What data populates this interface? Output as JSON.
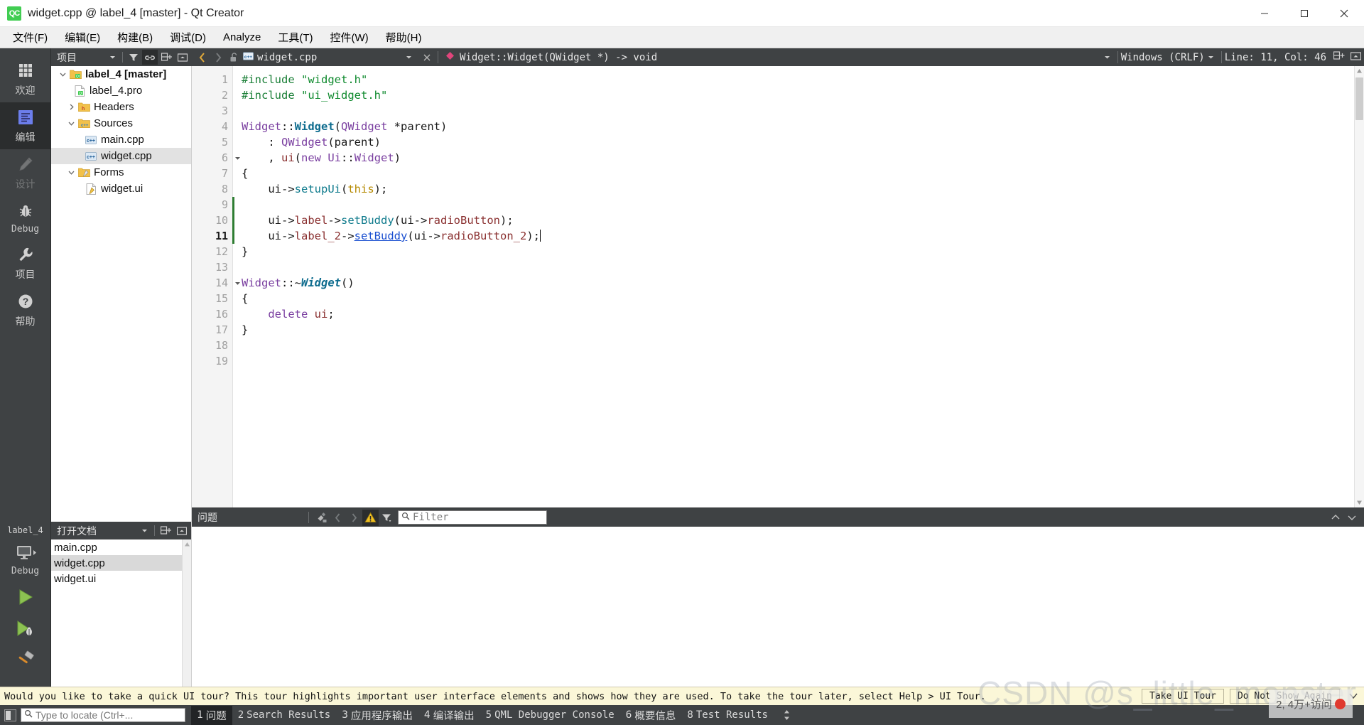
{
  "window": {
    "title": "widget.cpp @ label_4 [master] - Qt Creator",
    "app_icon_text": "QC",
    "controls": {
      "minimize": "minimize-icon",
      "maximize": "maximize-icon",
      "close": "close-icon"
    }
  },
  "menubar": {
    "items": [
      {
        "label": "文件(F)",
        "plain": "文件",
        "mnemonic": "F"
      },
      {
        "label": "编辑(E)",
        "plain": "编辑",
        "mnemonic": "E"
      },
      {
        "label": "构建(B)",
        "plain": "构建",
        "mnemonic": "B"
      },
      {
        "label": "调试(D)",
        "plain": "调试",
        "mnemonic": "D"
      },
      {
        "label": "Analyze",
        "plain": "Analyze",
        "mnemonic": "A"
      },
      {
        "label": "工具(T)",
        "plain": "工具",
        "mnemonic": "T"
      },
      {
        "label": "控件(W)",
        "plain": "控件",
        "mnemonic": "W"
      },
      {
        "label": "帮助(H)",
        "plain": "帮助",
        "mnemonic": "H"
      }
    ]
  },
  "modebar": {
    "items": [
      {
        "label": "欢迎",
        "icon": "grid-icon",
        "state": "normal"
      },
      {
        "label": "编辑",
        "icon": "editor-icon",
        "state": "active"
      },
      {
        "label": "设计",
        "icon": "pencil-icon",
        "state": "disabled"
      },
      {
        "label": "Debug",
        "icon": "bug-icon",
        "state": "normal"
      },
      {
        "label": "项目",
        "icon": "wrench-icon",
        "state": "normal"
      },
      {
        "label": "帮助",
        "icon": "question-circle-icon",
        "state": "normal"
      }
    ],
    "kit": {
      "project": "label_4",
      "icon": "monitor-icon",
      "build_config": "Debug"
    },
    "run_buttons": [
      {
        "name": "run-button",
        "icon": "play-triangle-icon"
      },
      {
        "name": "debug-button",
        "icon": "play-with-bug-icon"
      },
      {
        "name": "build-button",
        "icon": "hammer-icon"
      }
    ]
  },
  "project_dock": {
    "title": "项目",
    "tools": [
      "filter-icon",
      "link-icon",
      "split-icon",
      "close-dock-icon"
    ],
    "tree": [
      {
        "label": "label_4 [master]",
        "icon": "qt-project-folder-icon",
        "depth": 0,
        "expander": "down",
        "bold": true,
        "selected": false
      },
      {
        "label": "label_4.pro",
        "icon": "pro-file-icon",
        "depth": 1,
        "expander": "none",
        "bold": false,
        "selected": false
      },
      {
        "label": "Headers",
        "icon": "headers-folder-icon",
        "depth": 1,
        "expander": "right",
        "bold": false,
        "selected": false
      },
      {
        "label": "Sources",
        "icon": "sources-folder-icon",
        "depth": 1,
        "expander": "down",
        "bold": false,
        "selected": false
      },
      {
        "label": "main.cpp",
        "icon": "cpp-file-icon",
        "depth": 2,
        "expander": "none",
        "bold": false,
        "selected": false
      },
      {
        "label": "widget.cpp",
        "icon": "cpp-file-icon",
        "depth": 2,
        "expander": "none",
        "bold": false,
        "selected": true
      },
      {
        "label": "Forms",
        "icon": "forms-folder-icon",
        "depth": 1,
        "expander": "down",
        "bold": false,
        "selected": false
      },
      {
        "label": "widget.ui",
        "icon": "ui-file-icon",
        "depth": 2,
        "expander": "none",
        "bold": false,
        "selected": false
      }
    ]
  },
  "opendocs_dock": {
    "title": "打开文档",
    "tools": [
      "split-icon",
      "close-dock-icon"
    ],
    "items": [
      {
        "label": "main.cpp",
        "selected": false
      },
      {
        "label": "widget.cpp",
        "selected": true
      },
      {
        "label": "widget.ui",
        "selected": false
      }
    ]
  },
  "editor_toolbar": {
    "nav_back": "back-arrow-icon",
    "nav_forward": "forward-arrow-icon",
    "lock": "unlocked-icon",
    "file_icon": "cpp-file-icon",
    "file_name": "widget.cpp",
    "close_label": "×",
    "symbol_icon": "method-diamond-icon",
    "symbol": "Widget::Widget(QWidget *) -> void",
    "line_ending": "Windows (CRLF)",
    "cursor_position": "Line: 11, Col: 46",
    "split_icon": "split-editor-icon",
    "unsplit_icon": "close-split-icon"
  },
  "code": {
    "lines": [
      {
        "n": 1,
        "fold": "none",
        "changed": false,
        "current": false,
        "tokens": [
          {
            "t": "#include ",
            "c": "k-pre"
          },
          {
            "t": "\"widget.h\"",
            "c": "k-str"
          }
        ]
      },
      {
        "n": 2,
        "fold": "none",
        "changed": false,
        "current": false,
        "tokens": [
          {
            "t": "#include ",
            "c": "k-pre"
          },
          {
            "t": "\"ui_widget.h\"",
            "c": "k-str"
          }
        ]
      },
      {
        "n": 3,
        "fold": "none",
        "changed": false,
        "current": false,
        "tokens": []
      },
      {
        "n": 4,
        "fold": "none",
        "changed": false,
        "current": false,
        "tokens": [
          {
            "t": "Widget",
            "c": "k-type"
          },
          {
            "t": "::",
            "c": "k-op"
          },
          {
            "t": "Widget",
            "c": "k-typeb"
          },
          {
            "t": "(",
            "c": "k-op"
          },
          {
            "t": "QWidget",
            "c": "k-type"
          },
          {
            "t": " *parent",
            "c": "k-plain"
          },
          {
            "t": ")",
            "c": "k-op"
          }
        ]
      },
      {
        "n": 5,
        "fold": "none",
        "changed": false,
        "current": false,
        "tokens": [
          {
            "t": "    : ",
            "c": "k-op"
          },
          {
            "t": "QWidget",
            "c": "k-type"
          },
          {
            "t": "(parent)",
            "c": "k-op"
          }
        ]
      },
      {
        "n": 6,
        "fold": "down",
        "changed": false,
        "current": false,
        "tokens": [
          {
            "t": "    , ",
            "c": "k-op"
          },
          {
            "t": "ui",
            "c": "k-var"
          },
          {
            "t": "(",
            "c": "k-op"
          },
          {
            "t": "new",
            "c": "k-kw"
          },
          {
            "t": " ",
            "c": "k-plain"
          },
          {
            "t": "Ui",
            "c": "k-type"
          },
          {
            "t": "::",
            "c": "k-op"
          },
          {
            "t": "Widget",
            "c": "k-type"
          },
          {
            "t": ")",
            "c": "k-op"
          }
        ]
      },
      {
        "n": 7,
        "fold": "none",
        "changed": false,
        "current": false,
        "tokens": [
          {
            "t": "{",
            "c": "k-op"
          }
        ]
      },
      {
        "n": 8,
        "fold": "none",
        "changed": false,
        "current": false,
        "tokens": [
          {
            "t": "    ui",
            "c": "k-plain"
          },
          {
            "t": "->",
            "c": "k-op"
          },
          {
            "t": "setupUi",
            "c": "k-fn"
          },
          {
            "t": "(",
            "c": "k-op"
          },
          {
            "t": "this",
            "c": "k-this"
          },
          {
            "t": ");",
            "c": "k-op"
          }
        ]
      },
      {
        "n": 9,
        "fold": "none",
        "changed": true,
        "current": false,
        "tokens": []
      },
      {
        "n": 10,
        "fold": "none",
        "changed": true,
        "current": false,
        "tokens": [
          {
            "t": "    ui",
            "c": "k-plain"
          },
          {
            "t": "->",
            "c": "k-op"
          },
          {
            "t": "label",
            "c": "k-var"
          },
          {
            "t": "->",
            "c": "k-op"
          },
          {
            "t": "setBuddy",
            "c": "k-fn"
          },
          {
            "t": "(ui",
            "c": "k-op"
          },
          {
            "t": "->",
            "c": "k-op"
          },
          {
            "t": "radioButton",
            "c": "k-var"
          },
          {
            "t": ");",
            "c": "k-op"
          }
        ]
      },
      {
        "n": 11,
        "fold": "none",
        "changed": true,
        "current": true,
        "tokens": [
          {
            "t": "    ui",
            "c": "k-plain"
          },
          {
            "t": "->",
            "c": "k-op"
          },
          {
            "t": "label_2",
            "c": "k-var"
          },
          {
            "t": "->",
            "c": "k-op"
          },
          {
            "t": "setBuddy",
            "c": "k-fnu"
          },
          {
            "t": "(ui",
            "c": "k-op"
          },
          {
            "t": "->",
            "c": "k-op"
          },
          {
            "t": "radioButton_2",
            "c": "k-var"
          },
          {
            "t": ");",
            "c": "k-op"
          }
        ]
      },
      {
        "n": 12,
        "fold": "none",
        "changed": false,
        "current": false,
        "tokens": [
          {
            "t": "}",
            "c": "k-op"
          }
        ]
      },
      {
        "n": 13,
        "fold": "none",
        "changed": false,
        "current": false,
        "tokens": []
      },
      {
        "n": 14,
        "fold": "down",
        "changed": false,
        "current": false,
        "tokens": [
          {
            "t": "Widget",
            "c": "k-type"
          },
          {
            "t": "::~",
            "c": "k-op"
          },
          {
            "t": "Widget",
            "c": "k-typebi"
          },
          {
            "t": "()",
            "c": "k-op"
          }
        ]
      },
      {
        "n": 15,
        "fold": "none",
        "changed": false,
        "current": false,
        "tokens": [
          {
            "t": "{",
            "c": "k-op"
          }
        ]
      },
      {
        "n": 16,
        "fold": "none",
        "changed": false,
        "current": false,
        "tokens": [
          {
            "t": "    ",
            "c": "k-plain"
          },
          {
            "t": "delete",
            "c": "k-kw"
          },
          {
            "t": " ",
            "c": "k-plain"
          },
          {
            "t": "ui",
            "c": "k-var"
          },
          {
            "t": ";",
            "c": "k-op"
          }
        ]
      },
      {
        "n": 17,
        "fold": "none",
        "changed": false,
        "current": false,
        "tokens": [
          {
            "t": "}",
            "c": "k-op"
          }
        ]
      },
      {
        "n": 18,
        "fold": "none",
        "changed": false,
        "current": false,
        "tokens": []
      },
      {
        "n": 19,
        "fold": "none",
        "changed": false,
        "current": false,
        "tokens": []
      }
    ]
  },
  "issues_pane": {
    "title": "问题",
    "clear_icon": "clear-icon",
    "prev_icon": "prev-arrow-icon",
    "next_icon": "next-arrow-icon",
    "warning_icon": "warning-triangle-icon",
    "filter_icon": "filter-funnel-icon",
    "filter_placeholder": "Filter",
    "search_icon": "search-icon",
    "maximize_icon": "chevron-up-icon",
    "close_icon": "chevron-down-icon"
  },
  "tour_banner": {
    "message": "Would you like to take a quick UI tour? This tour highlights important user interface elements and shows how they are used. To take the tour later, select Help > UI Tour.",
    "primary_button": "Take UI Tour",
    "secondary_button": "Do Not Show Again",
    "close_icon": "chevron-close-icon",
    "background_color": "#fbf7d8"
  },
  "statusbar": {
    "sidebar_toggle_icon": "sidebar-toggle-icon",
    "locator_placeholder": "Type to locate (Ctrl+...",
    "locator_search_icon": "search-icon",
    "tabs": [
      {
        "num": "1",
        "label": "问题",
        "active": true,
        "cn": true
      },
      {
        "num": "2",
        "label": "Search Results",
        "active": false,
        "cn": false
      },
      {
        "num": "3",
        "label": "应用程序输出",
        "active": false,
        "cn": true
      },
      {
        "num": "4",
        "label": "编译输出",
        "active": false,
        "cn": true
      },
      {
        "num": "5",
        "label": "QML Debugger Console",
        "active": false,
        "cn": false
      },
      {
        "num": "6",
        "label": "概要信息",
        "active": false,
        "cn": true
      },
      {
        "num": "8",
        "label": "Test Results",
        "active": false,
        "cn": false
      }
    ],
    "updown_icon": "up-down-arrows-icon"
  },
  "watermark": {
    "text": "CSDN @s_little_monster",
    "badge_text": "2, 4万+访问",
    "badge_dot_color": "#e03a2f"
  },
  "colors": {
    "dark_chrome": "#3f4244",
    "dark_chrome_active": "#2b2d2e",
    "accent_green": "#41cd52",
    "change_bar": "#2e7d32",
    "banner": "#fbf7d8"
  }
}
